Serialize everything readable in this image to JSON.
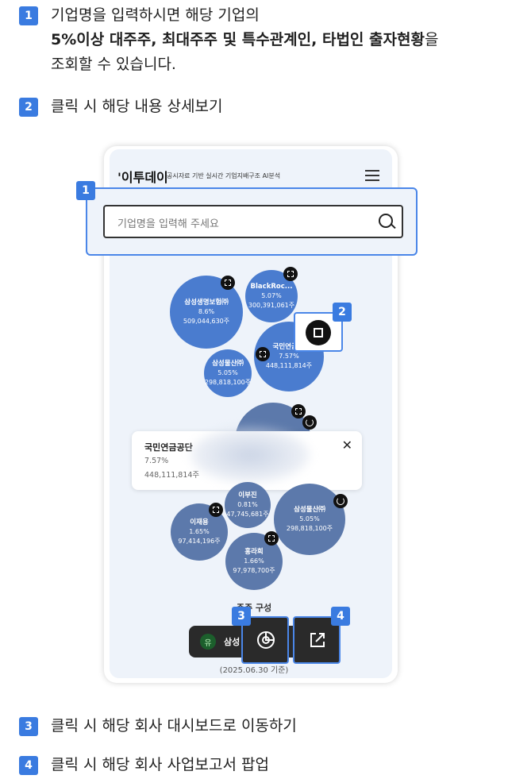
{
  "steps": {
    "s1": {
      "num": "1",
      "line1": "기업명을 입력하시면 해당 기업의",
      "line2": "5%이상 대주주, 최대주주 및 특수관계인, 타법인 출자현황",
      "line2_tail": "을",
      "line3": "조회할 수 있습니다."
    },
    "s2": {
      "num": "2",
      "text": "클릭 시 해당 내용 상세보기"
    },
    "s3": {
      "num": "3",
      "text": "클릭 시 해당 회사 대시보드로 이동하기"
    },
    "s4": {
      "num": "4",
      "text": "클릭 시 해당 회사 사업보고서 팝업"
    }
  },
  "phone": {
    "logo": "'이투데이",
    "tagline": "공시자료 기반 실시간 기업지배구조 AI분석",
    "search_placeholder": "기업명을 입력해 주세요",
    "callout1": "1",
    "callout2": "2",
    "callout3": "3",
    "callout4": "4",
    "bubbles_top": [
      {
        "name": "삼성생명보험㈜",
        "pct": "8.6%",
        "shares": "509,044,630주"
      },
      {
        "name": "BlackRoc...",
        "pct": "5.07%",
        "shares": "300,391,061주"
      },
      {
        "name": "국민연금...",
        "pct": "7.57%",
        "shares": "448,111,814주"
      },
      {
        "name": "삼성물산㈜",
        "pct": "5.05%",
        "shares": "298,818,100주"
      }
    ],
    "popup": {
      "title": "국민연금공단",
      "pct": "7.57%",
      "shares": "448,111,814주",
      "close": "✕"
    },
    "bubbles_bottom": [
      {
        "name": "이부진",
        "pct": "0.81%",
        "shares": "47,745,681주"
      },
      {
        "name": "삼성물산㈜",
        "pct": "5.05%",
        "shares": "298,818,100주"
      },
      {
        "name": "이재용",
        "pct": "1.65%",
        "shares": "97,414,196주"
      },
      {
        "name": "홍라희",
        "pct": "1.66%",
        "shares": "97,978,700주"
      }
    ],
    "section_label": "주주 구성",
    "pill_badge": "유",
    "pill_name": "삼성",
    "date": "(2025.06.30 기준)"
  },
  "colors": {
    "accent": "#3a7be0",
    "bubble": "#4a7ccf"
  }
}
